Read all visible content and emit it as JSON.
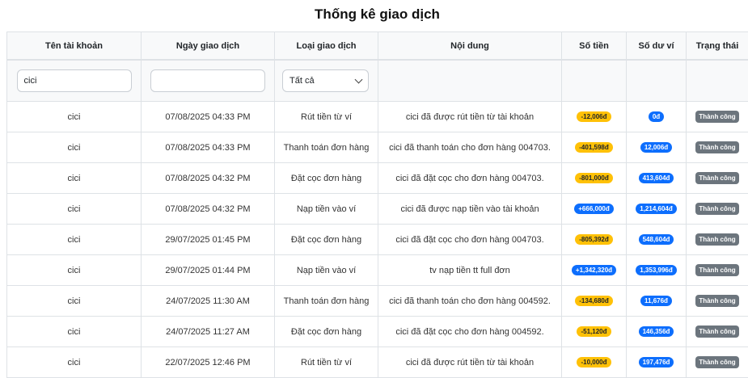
{
  "title": "Thống kê giao dịch",
  "columns": [
    "Tên tài khoản",
    "Ngày giao dịch",
    "Loại giao dịch",
    "Nội dung",
    "Số tiền",
    "Số dư ví",
    "Trạng thái"
  ],
  "filters": {
    "account_value": "cici",
    "date_value": "",
    "type_selected": "Tất cả"
  },
  "rows": [
    {
      "account": "cici",
      "date": "07/08/2025 04:33 PM",
      "type": "Rút tiền từ ví",
      "content": "cici đã được rút tiền từ tài khoản",
      "amount": "-12,006đ",
      "amount_sign": "neg",
      "balance": "0đ",
      "status": "Thành công"
    },
    {
      "account": "cici",
      "date": "07/08/2025 04:33 PM",
      "type": "Thanh toán đơn hàng",
      "content": "cici đã thanh toán cho đơn hàng 004703.",
      "amount": "-401,598đ",
      "amount_sign": "neg",
      "balance": "12,006đ",
      "status": "Thành công"
    },
    {
      "account": "cici",
      "date": "07/08/2025 04:32 PM",
      "type": "Đặt cọc đơn hàng",
      "content": "cici đã đặt cọc cho đơn hàng 004703.",
      "amount": "-801,000đ",
      "amount_sign": "neg",
      "balance": "413,604đ",
      "status": "Thành công"
    },
    {
      "account": "cici",
      "date": "07/08/2025 04:32 PM",
      "type": "Nạp tiền vào ví",
      "content": "cici đã được nạp tiền vào tài khoản",
      "amount": "+666,000đ",
      "amount_sign": "pos",
      "balance": "1,214,604đ",
      "status": "Thành công"
    },
    {
      "account": "cici",
      "date": "29/07/2025 01:45 PM",
      "type": "Đặt cọc đơn hàng",
      "content": "cici đã đặt cọc cho đơn hàng 004703.",
      "amount": "-805,392đ",
      "amount_sign": "neg",
      "balance": "548,604đ",
      "status": "Thành công"
    },
    {
      "account": "cici",
      "date": "29/07/2025 01:44 PM",
      "type": "Nạp tiền vào ví",
      "content": "tv nạp tiền tt full đơn",
      "amount": "+1,342,320đ",
      "amount_sign": "pos",
      "balance": "1,353,996đ",
      "status": "Thành công"
    },
    {
      "account": "cici",
      "date": "24/07/2025 11:30 AM",
      "type": "Thanh toán đơn hàng",
      "content": "cici đã thanh toán cho đơn hàng 004592.",
      "amount": "-134,680đ",
      "amount_sign": "neg",
      "balance": "11,676đ",
      "status": "Thành công"
    },
    {
      "account": "cici",
      "date": "24/07/2025 11:27 AM",
      "type": "Đặt cọc đơn hàng",
      "content": "cici đã đặt cọc cho đơn hàng 004592.",
      "amount": "-51,120đ",
      "amount_sign": "neg",
      "balance": "146,356đ",
      "status": "Thành công"
    },
    {
      "account": "cici",
      "date": "22/07/2025 12:46 PM",
      "type": "Rút tiền từ ví",
      "content": "cici đã được rút tiền từ tài khoản",
      "amount": "-10,000đ",
      "amount_sign": "neg",
      "balance": "197,476đ",
      "status": "Thành công"
    }
  ]
}
